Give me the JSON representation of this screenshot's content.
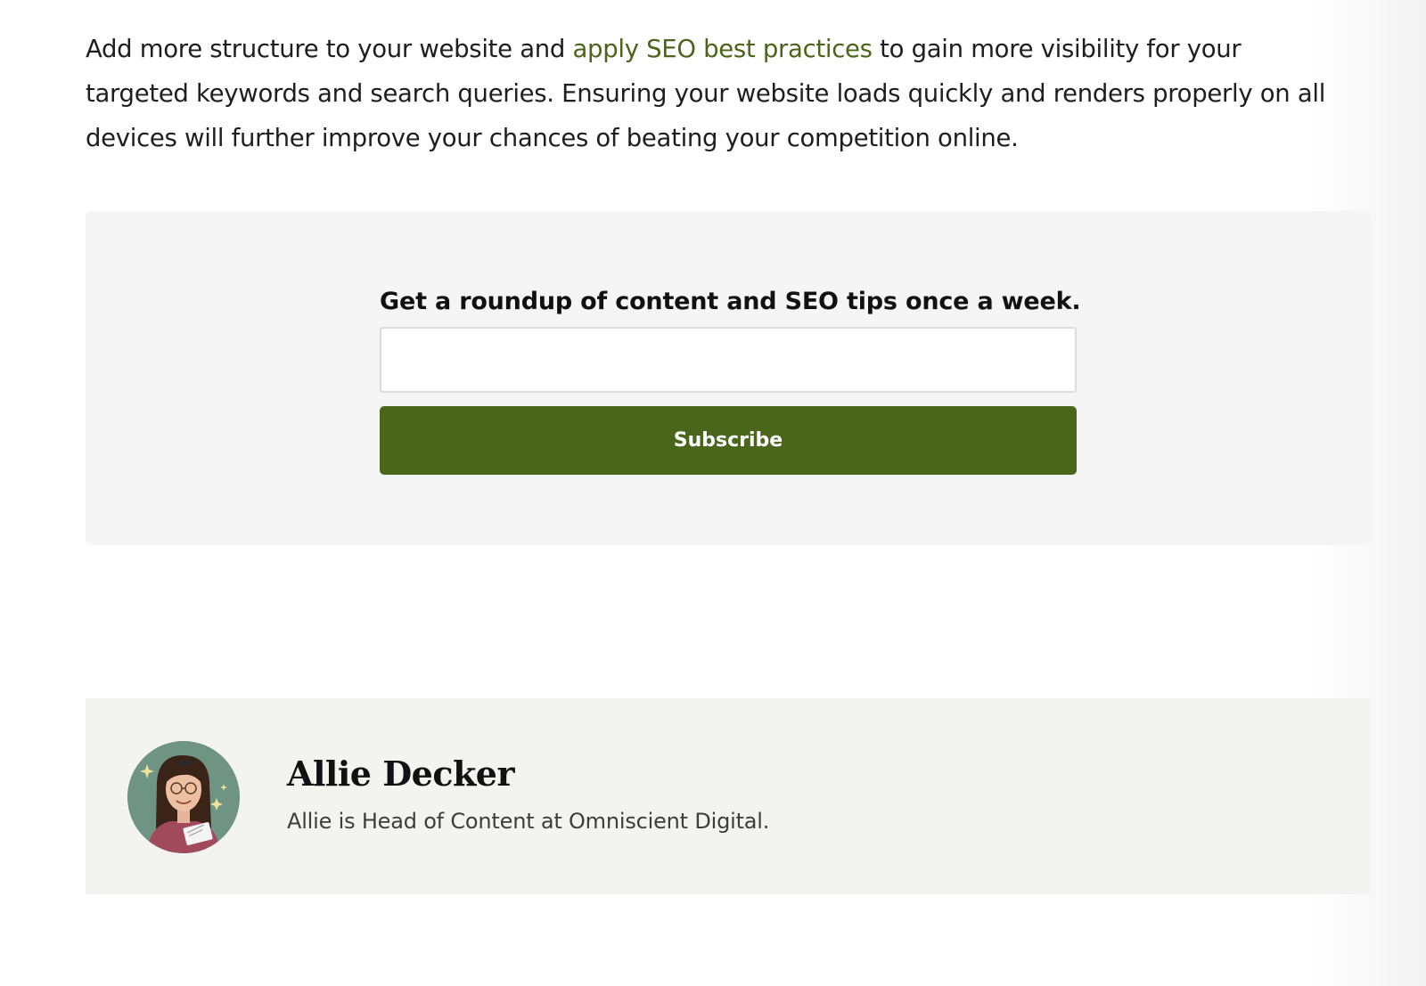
{
  "article": {
    "intro_before_link": "Add more structure to your website and ",
    "intro_link": "apply SEO best practices",
    "intro_after_link": " to gain more visibility for your targeted keywords and search queries. Ensuring your website loads quickly and renders properly on all devices will further improve your chances of beating your competition online."
  },
  "newsletter": {
    "heading": "Get a roundup of content and SEO tips once a week.",
    "email_value": "",
    "subscribe_label": "Subscribe"
  },
  "author": {
    "name": "Allie Decker",
    "bio": "Allie is Head of Content at Omniscient Digital.",
    "avatar_icon": "author-portrait"
  },
  "colors": {
    "link_green": "#4a6419",
    "button_green": "#4a661a",
    "signup_bg": "#f5f5f5",
    "author_bg": "#f3f3f0",
    "avatar_bg": "#6f9484"
  }
}
